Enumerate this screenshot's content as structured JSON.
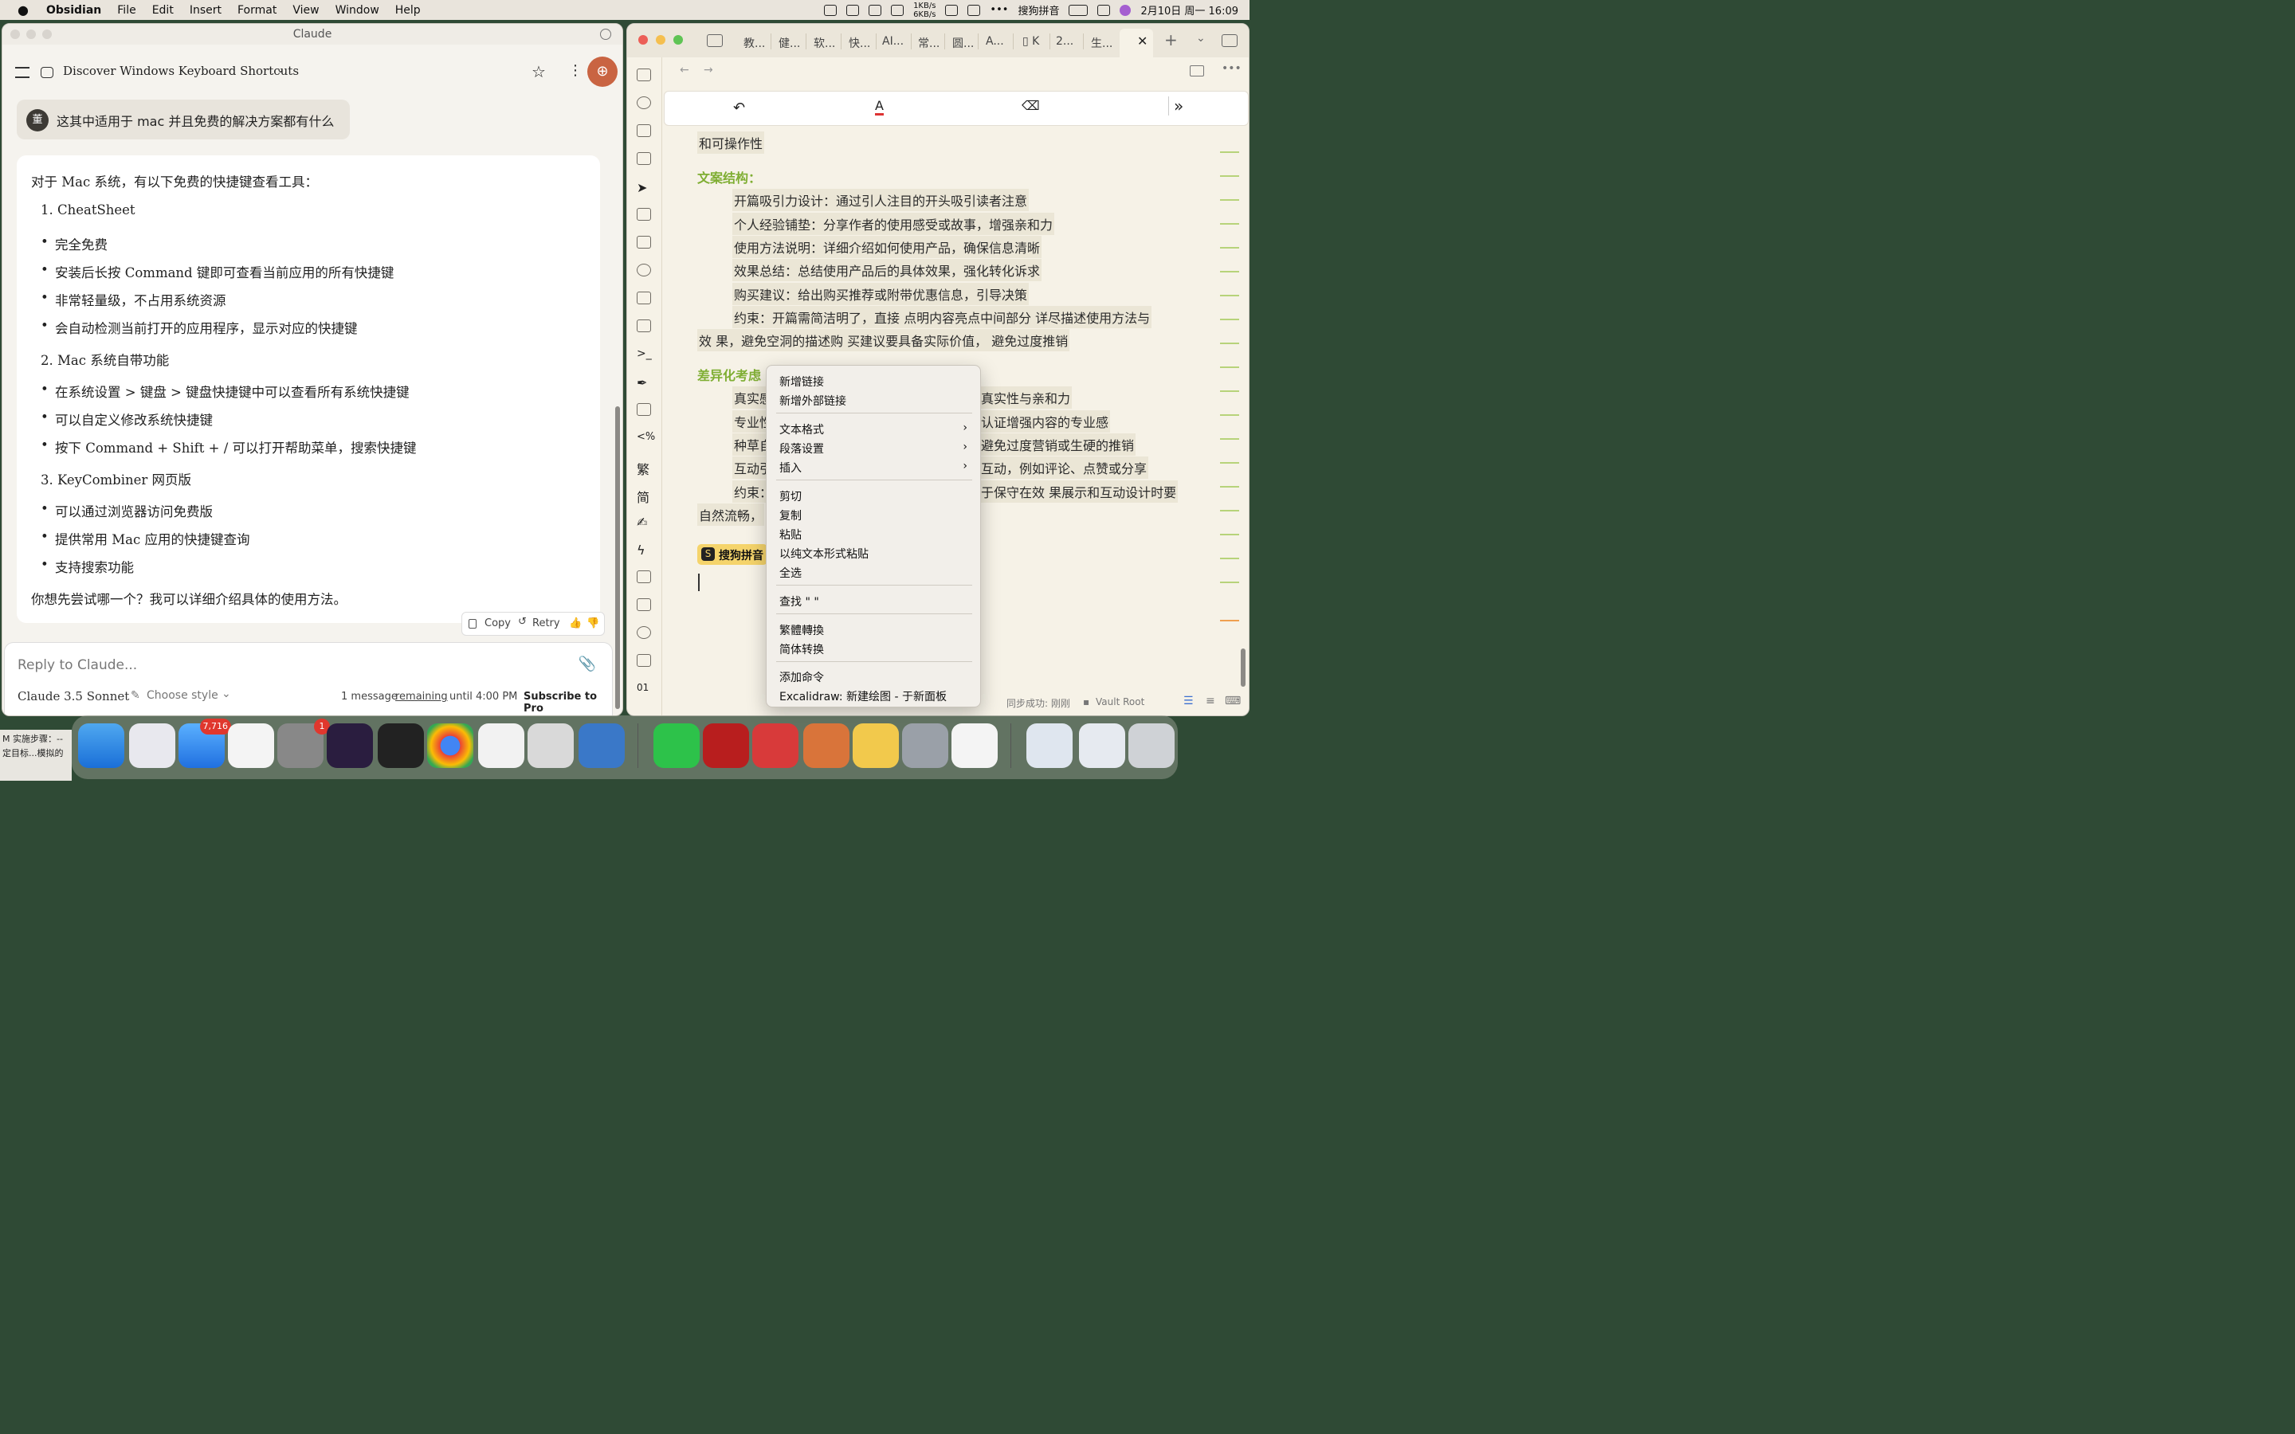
{
  "menubar": {
    "app": "Obsidian",
    "items": [
      "File",
      "Edit",
      "Insert",
      "Format",
      "View",
      "Window",
      "Help"
    ],
    "net_up": "1KB/s",
    "net_down": "6KB/s",
    "ime": "搜狗拼音",
    "datetime": "2月10日 周一  16:09"
  },
  "claude": {
    "window_title": "Claude",
    "chat_title": "Discover Windows Keyboard Shortcuts",
    "user_avatar": "董",
    "user_message": "这其中适用于 mac 并且免费的解决方案都有什么",
    "answer": {
      "intro": "对于 Mac 系统，有以下免费的快捷键查看工具：",
      "s1": "1. CheatSheet",
      "s1b": [
        "完全免费",
        "安装后长按 Command 键即可查看当前应用的所有快捷键",
        "非常轻量级，不占用系统资源",
        "会自动检测当前打开的应用程序，显示对应的快捷键"
      ],
      "s2": "2. Mac 系统自带功能",
      "s2b": [
        "在系统设置 > 键盘 > 键盘快捷键中可以查看所有系统快捷键",
        "可以自定义修改系统快捷键",
        "按下 Command + Shift + / 可以打开帮助菜单，搜索快捷键"
      ],
      "s3": "3. KeyCombiner 网页版",
      "s3b": [
        "可以通过浏览器访问免费版",
        "提供常用 Mac 应用的快捷键查询",
        "支持搜索功能"
      ],
      "outro": "你想先尝试哪一个？我可以详细介绍具体的使用方法。"
    },
    "actions": {
      "copy": "Copy",
      "retry": "Retry"
    },
    "reply_placeholder": "Reply to Claude...",
    "model": "Claude 3.5 Sonnet",
    "style": "Choose style",
    "limit": {
      "a": "1 message",
      "b": "remaining",
      "c": "until",
      "d": "4:00 PM"
    },
    "subscribe": "Subscribe to Pro"
  },
  "obsidian": {
    "tabs": [
      "教...",
      "健...",
      "软...",
      "快...",
      "AI...",
      "常...",
      "圆...",
      "A...",
      "K",
      "2...",
      "生..."
    ],
    "doc": {
      "l0": "和可操作性",
      "h1": "文案结构：",
      "items1": [
        "开篇吸引力设计：通过引人注目的开头吸引读者注意",
        "个人经验铺垫：分享作者的使用感受或故事，增强亲和力",
        "使用方法说明：详细介绍如何使用产品，确保信息清晰",
        "效果总结：总结使用产品后的具体效果，强化转化诉求",
        "购买建议：给出购买推荐或附带优惠信息，引导决策",
        "约束：开篇需简洁明了，直接  点明内容亮点中间部分  详尽描述使用方法与"
      ],
      "wrap1": "效  果，避免空洞的描述购  买建议要具备实际价值，    避免过度推销",
      "h2": "差异化考虑",
      "items2_left": [
        "真实感",
        "专业性",
        "种草自",
        "互动引",
        "约束："
      ],
      "items2_right": [
        "真实性与亲和力",
        "认证增强内容的专业感",
        "避免过度营销或生硬的推销",
        "互动，例如评论、点赞或分享",
        "于保守在效  果展示和互动设计时要"
      ],
      "wrap2": "自然流畅，"
    },
    "ime_badge": "搜狗拼音",
    "status": {
      "sync": "同步成功: 刚刚",
      "vault": "Vault Root"
    }
  },
  "context_menu": {
    "g1": [
      "新增链接",
      "新增外部链接"
    ],
    "g2": [
      "文本格式",
      "段落设置",
      "插入"
    ],
    "g3": [
      "剪切",
      "复制",
      "粘贴",
      "以纯文本形式粘贴",
      "全选"
    ],
    "g4": [
      "查找 \" \""
    ],
    "g5": [
      "繁體轉換",
      "简体转换"
    ],
    "g6": [
      "添加命令",
      "Excalidraw: 新建绘图 - 于新面板"
    ]
  },
  "dock": {
    "mail_badge": "7,716",
    "settings_badge": "1",
    "left_note_1": "M 实施步骤：--",
    "left_note_2": "定目标...模拟的"
  }
}
